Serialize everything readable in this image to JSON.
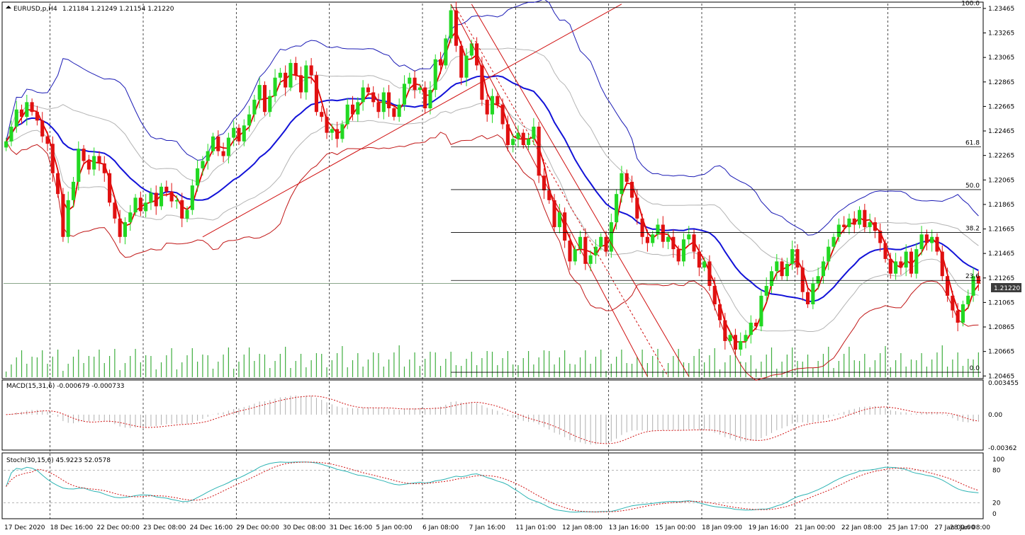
{
  "window": {
    "symbol_label": "EURUSD,p,H4",
    "ohlc_label": "1.21184 1.21249 1.21154 1.21220",
    "current_price_label": "1.21220"
  },
  "chart_data": {
    "type": "candlestick",
    "symbol": "EURUSD,p",
    "timeframe": "H4",
    "price_axis_ticks": [
      "1.23465",
      "1.23265",
      "1.23065",
      "1.22865",
      "1.22665",
      "1.22465",
      "1.22265",
      "1.22065",
      "1.21865",
      "1.21665",
      "1.21465",
      "1.21265",
      "1.21065",
      "1.20865",
      "1.20665",
      "1.20465"
    ],
    "price_range": [
      1.20455,
      1.23505
    ],
    "time_axis_labels": [
      "17 Dec 2020",
      "18 Dec 16:00",
      "22 Dec 00:00",
      "23 Dec 08:00",
      "24 Dec 16:00",
      "29 Dec 00:00",
      "30 Dec 08:00",
      "31 Dec 16:00",
      "5 Jan 00:00",
      "6 Jan 08:00",
      "7 Jan 16:00",
      "11 Jan 01:00",
      "12 Jan 08:00",
      "13 Jan 16:00",
      "15 Jan 00:00",
      "18 Jan 09:00",
      "19 Jan 16:00",
      "21 Jan 00:00",
      "22 Jan 08:00",
      "25 Jan 17:00",
      "27 Jan 00:00",
      "28 Jan 08:00"
    ],
    "current_price": 1.2122,
    "fibonacci_levels": [
      {
        "label": "100.0",
        "price": 1.23472
      },
      {
        "label": "61.8",
        "price": 1.22336
      },
      {
        "label": "50.0",
        "price": 1.21986
      },
      {
        "label": "38.2",
        "price": 1.21636
      },
      {
        "label": "23.6",
        "price": 1.21245
      },
      {
        "label": "0.0",
        "price": 1.20495
      }
    ],
    "close_series": [
      1.2238,
      1.225,
      1.2264,
      1.2258,
      1.227,
      1.2262,
      1.2255,
      1.2242,
      1.2236,
      1.2212,
      1.2195,
      1.216,
      1.219,
      1.2205,
      1.2232,
      1.2222,
      1.2215,
      1.2226,
      1.222,
      1.2212,
      1.2188,
      1.2175,
      1.216,
      1.2172,
      1.218,
      1.2192,
      1.2181,
      1.2188,
      1.2196,
      1.2185,
      1.2201,
      1.2197,
      1.2189,
      1.219,
      1.2175,
      1.2182,
      1.2202,
      1.2216,
      1.2222,
      1.223,
      1.2242,
      1.223,
      1.2226,
      1.2241,
      1.2249,
      1.2238,
      1.2251,
      1.226,
      1.2272,
      1.2284,
      1.2262,
      1.2275,
      1.229,
      1.2294,
      1.2282,
      1.2302,
      1.2292,
      1.2278,
      1.23,
      1.2292,
      1.2262,
      1.2258,
      1.2245,
      1.2248,
      1.224,
      1.2252,
      1.2268,
      1.226,
      1.227,
      1.2282,
      1.2278,
      1.227,
      1.2262,
      1.2278,
      1.2265,
      1.2258,
      1.2268,
      1.2285,
      1.229,
      1.228,
      1.2282,
      1.2265,
      1.228,
      1.2305,
      1.23,
      1.2322,
      1.2345,
      1.2316,
      1.229,
      1.2308,
      1.2318,
      1.23,
      1.2272,
      1.226,
      1.2275,
      1.2268,
      1.2252,
      1.2235,
      1.224,
      1.2245,
      1.2235,
      1.224,
      1.225,
      1.221,
      1.2198,
      1.219,
      1.2168,
      1.218,
      1.2157,
      1.214,
      1.215,
      1.216,
      1.2138,
      1.2145,
      1.2152,
      1.216,
      1.2148,
      1.2172,
      1.2195,
      1.2212,
      1.2205,
      1.2192,
      1.2175,
      1.216,
      1.2155,
      1.2162,
      1.217,
      1.2156,
      1.216,
      1.215,
      1.214,
      1.2158,
      1.2162,
      1.2148,
      1.2135,
      1.214,
      1.212,
      1.2105,
      1.2092,
      1.2075,
      1.208,
      1.2068,
      1.2075,
      1.208,
      1.209,
      1.2087,
      1.2112,
      1.212,
      1.2132,
      1.214,
      1.2128,
      1.2138,
      1.215,
      1.2135,
      1.2115,
      1.2105,
      1.2122,
      1.2128,
      1.214,
      1.2152,
      1.216,
      1.217,
      1.2168,
      1.2175,
      1.217,
      1.2182,
      1.2168,
      1.2172,
      1.2165,
      1.2155,
      1.2142,
      1.213,
      1.214,
      1.2135,
      1.2148,
      1.213,
      1.215,
      1.2162,
      1.2155,
      1.216,
      1.2148,
      1.2128,
      1.2112,
      1.21,
      1.209,
      1.2105,
      1.2112,
      1.2128,
      1.2122
    ]
  },
  "macd": {
    "label": "MACD(15,31,6) -0.000679 -0.000733",
    "axis_ticks": [
      "0.003455",
      "0.00",
      "-0.00362"
    ]
  },
  "stoch": {
    "label": "Stoch(30,15,6) 45.9223 52.0578",
    "axis_ticks": [
      "100",
      "80",
      "20",
      "0"
    ]
  }
}
